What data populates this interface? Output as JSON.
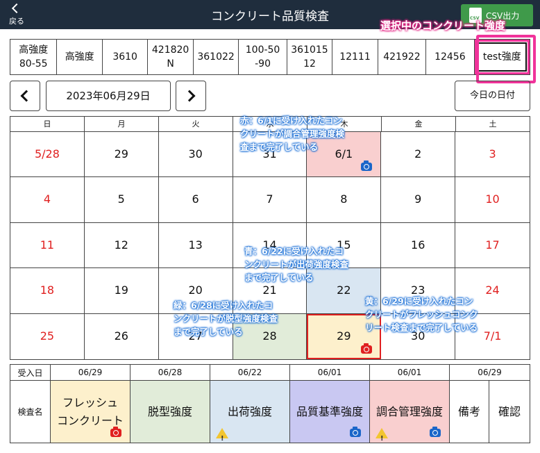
{
  "header": {
    "back_label": "戻る",
    "title": "コンクリート品質検査",
    "csv_button": "CSV出力",
    "bg_color": "#1f2d3d",
    "csv_color": "#3f9a4a"
  },
  "strength_callout": "選択中のコンクリート強度",
  "strengths": [
    "高強度\n80-55",
    "高強度",
    "3610",
    "421820\nN",
    "361022",
    "100-50\n-90",
    "361015\n12",
    "12111",
    "421922",
    "12456",
    "test強度"
  ],
  "selected_strength": "test強度",
  "date_nav": {
    "current_date": "2023年06月29日",
    "today_button": "今日の日付"
  },
  "calendar": {
    "weekdays": [
      "日",
      "月",
      "火",
      "水",
      "木",
      "金",
      "土"
    ],
    "weeks": [
      [
        "5/28",
        "29",
        "30",
        "31",
        "6/1",
        "2",
        "3"
      ],
      [
        "4",
        "5",
        "6",
        "7",
        "8",
        "9",
        "10"
      ],
      [
        "11",
        "12",
        "13",
        "14",
        "15",
        "16",
        "17"
      ],
      [
        "18",
        "19",
        "20",
        "21",
        "22",
        "23",
        "24"
      ],
      [
        "25",
        "26",
        "27",
        "28",
        "29",
        "30",
        "7/1"
      ]
    ]
  },
  "notes": {
    "red": "赤：6/1に受け入れたコン\nクリートが調合管理強度検\n査まで完了している",
    "blue": "青：6/22に受け入れたコ\nンクリートが出荷強度検査\nまで完了している",
    "green": "緑：6/28に受け入れたコ\nンクリートが脱型強度検査\nまで完了している",
    "yellow": "黄：6/29に受け入れたコン\nクリートがフレッシュコンク\nリート検査まで完了している"
  },
  "inspection_table": {
    "received_label": "受入日",
    "name_label": "検査名",
    "dates": [
      "06/29",
      "06/28",
      "06/22",
      "06/01",
      "06/01",
      "06/29"
    ],
    "names": [
      "フレッシュ\nコンクリート",
      "脱型強度",
      "出荷強度",
      "品質基準強度",
      "調合管理強度",
      "備考",
      "確認"
    ]
  },
  "colors": {
    "red": "#f9cfcf",
    "blue": "#d9e6f2",
    "green": "#e1ecd9",
    "yellow": "#fdf0cc",
    "purple": "#c9c8f2",
    "highlight": "#f0339a"
  },
  "icons": {
    "camera": "camera-icon",
    "warning": "warning-icon",
    "csv": "csv-file-icon",
    "back": "chevron-left-icon"
  }
}
